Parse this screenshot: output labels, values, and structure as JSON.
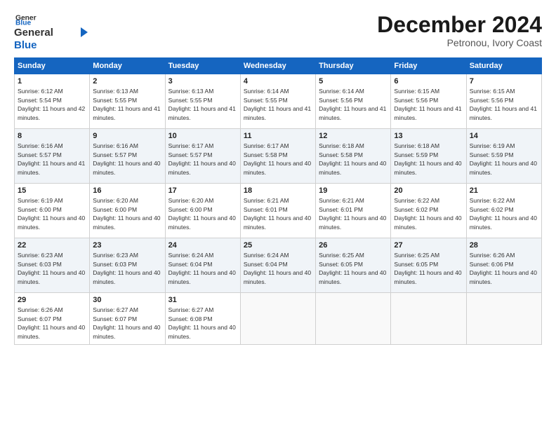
{
  "header": {
    "logo_general": "General",
    "logo_blue": "Blue",
    "month_title": "December 2024",
    "subtitle": "Petronou, Ivory Coast"
  },
  "days_of_week": [
    "Sunday",
    "Monday",
    "Tuesday",
    "Wednesday",
    "Thursday",
    "Friday",
    "Saturday"
  ],
  "weeks": [
    [
      {
        "day": 1,
        "sunrise": "6:12 AM",
        "sunset": "5:54 PM",
        "daylight": "11 hours and 42 minutes."
      },
      {
        "day": 2,
        "sunrise": "6:13 AM",
        "sunset": "5:55 PM",
        "daylight": "11 hours and 41 minutes."
      },
      {
        "day": 3,
        "sunrise": "6:13 AM",
        "sunset": "5:55 PM",
        "daylight": "11 hours and 41 minutes."
      },
      {
        "day": 4,
        "sunrise": "6:14 AM",
        "sunset": "5:55 PM",
        "daylight": "11 hours and 41 minutes."
      },
      {
        "day": 5,
        "sunrise": "6:14 AM",
        "sunset": "5:56 PM",
        "daylight": "11 hours and 41 minutes."
      },
      {
        "day": 6,
        "sunrise": "6:15 AM",
        "sunset": "5:56 PM",
        "daylight": "11 hours and 41 minutes."
      },
      {
        "day": 7,
        "sunrise": "6:15 AM",
        "sunset": "5:56 PM",
        "daylight": "11 hours and 41 minutes."
      }
    ],
    [
      {
        "day": 8,
        "sunrise": "6:16 AM",
        "sunset": "5:57 PM",
        "daylight": "11 hours and 41 minutes."
      },
      {
        "day": 9,
        "sunrise": "6:16 AM",
        "sunset": "5:57 PM",
        "daylight": "11 hours and 40 minutes."
      },
      {
        "day": 10,
        "sunrise": "6:17 AM",
        "sunset": "5:57 PM",
        "daylight": "11 hours and 40 minutes."
      },
      {
        "day": 11,
        "sunrise": "6:17 AM",
        "sunset": "5:58 PM",
        "daylight": "11 hours and 40 minutes."
      },
      {
        "day": 12,
        "sunrise": "6:18 AM",
        "sunset": "5:58 PM",
        "daylight": "11 hours and 40 minutes."
      },
      {
        "day": 13,
        "sunrise": "6:18 AM",
        "sunset": "5:59 PM",
        "daylight": "11 hours and 40 minutes."
      },
      {
        "day": 14,
        "sunrise": "6:19 AM",
        "sunset": "5:59 PM",
        "daylight": "11 hours and 40 minutes."
      }
    ],
    [
      {
        "day": 15,
        "sunrise": "6:19 AM",
        "sunset": "6:00 PM",
        "daylight": "11 hours and 40 minutes."
      },
      {
        "day": 16,
        "sunrise": "6:20 AM",
        "sunset": "6:00 PM",
        "daylight": "11 hours and 40 minutes."
      },
      {
        "day": 17,
        "sunrise": "6:20 AM",
        "sunset": "6:00 PM",
        "daylight": "11 hours and 40 minutes."
      },
      {
        "day": 18,
        "sunrise": "6:21 AM",
        "sunset": "6:01 PM",
        "daylight": "11 hours and 40 minutes."
      },
      {
        "day": 19,
        "sunrise": "6:21 AM",
        "sunset": "6:01 PM",
        "daylight": "11 hours and 40 minutes."
      },
      {
        "day": 20,
        "sunrise": "6:22 AM",
        "sunset": "6:02 PM",
        "daylight": "11 hours and 40 minutes."
      },
      {
        "day": 21,
        "sunrise": "6:22 AM",
        "sunset": "6:02 PM",
        "daylight": "11 hours and 40 minutes."
      }
    ],
    [
      {
        "day": 22,
        "sunrise": "6:23 AM",
        "sunset": "6:03 PM",
        "daylight": "11 hours and 40 minutes."
      },
      {
        "day": 23,
        "sunrise": "6:23 AM",
        "sunset": "6:03 PM",
        "daylight": "11 hours and 40 minutes."
      },
      {
        "day": 24,
        "sunrise": "6:24 AM",
        "sunset": "6:04 PM",
        "daylight": "11 hours and 40 minutes."
      },
      {
        "day": 25,
        "sunrise": "6:24 AM",
        "sunset": "6:04 PM",
        "daylight": "11 hours and 40 minutes."
      },
      {
        "day": 26,
        "sunrise": "6:25 AM",
        "sunset": "6:05 PM",
        "daylight": "11 hours and 40 minutes."
      },
      {
        "day": 27,
        "sunrise": "6:25 AM",
        "sunset": "6:05 PM",
        "daylight": "11 hours and 40 minutes."
      },
      {
        "day": 28,
        "sunrise": "6:26 AM",
        "sunset": "6:06 PM",
        "daylight": "11 hours and 40 minutes."
      }
    ],
    [
      {
        "day": 29,
        "sunrise": "6:26 AM",
        "sunset": "6:07 PM",
        "daylight": "11 hours and 40 minutes."
      },
      {
        "day": 30,
        "sunrise": "6:27 AM",
        "sunset": "6:07 PM",
        "daylight": "11 hours and 40 minutes."
      },
      {
        "day": 31,
        "sunrise": "6:27 AM",
        "sunset": "6:08 PM",
        "daylight": "11 hours and 40 minutes."
      },
      null,
      null,
      null,
      null
    ]
  ]
}
